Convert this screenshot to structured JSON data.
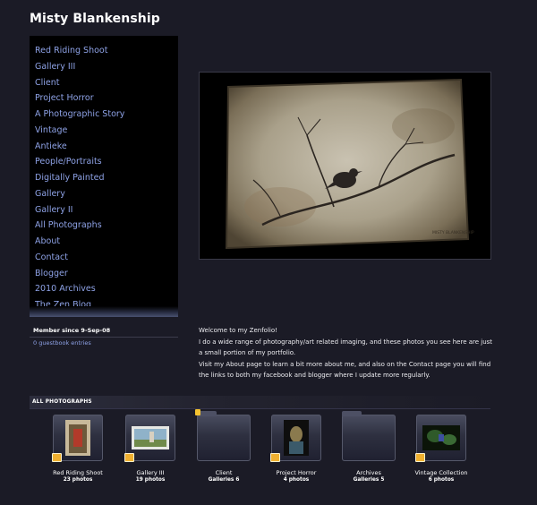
{
  "site": {
    "title": "Misty Blankenship"
  },
  "nav": {
    "items": [
      "Red Riding Shoot",
      "Gallery III",
      "Client",
      "Project Horror",
      "A Photographic Story",
      "Vintage",
      "Antieke",
      "People/Portraits",
      "Digitally Painted",
      "Gallery",
      "Gallery II",
      "All Photographs",
      "About",
      "Contact",
      "Blogger",
      "2010 Archives",
      "The Zen Blog"
    ]
  },
  "member": {
    "since": "Member since 9-Sep-08",
    "guestbook": "0 guestbook entries"
  },
  "feature_image": {
    "watermark": "MISTY BLANKENSHIP"
  },
  "welcome": {
    "heading": "Welcome to my Zenfolio!",
    "para1": "I do a wide range of photography/art related imaging, and these photos you see here are just a small portion of my portfolio.",
    "para2": "Visit my About page to learn a bit more about me, and also on the Contact page you will find the links to both my facebook and blogger where I update more regularly."
  },
  "section": {
    "label": "ALL PHOTOGRAPHS"
  },
  "galleries": [
    {
      "title": "Red Riding Shoot",
      "count": "23 photos",
      "kind": "gallery",
      "icon": "photo-stack-icon"
    },
    {
      "title": "Gallery III",
      "count": "19 photos",
      "kind": "gallery",
      "icon": "photo-stack-icon"
    },
    {
      "title": "Client",
      "count": "Galleries 6",
      "kind": "folder",
      "icon": "folder-icon"
    },
    {
      "title": "Project Horror",
      "count": "4 photos",
      "kind": "gallery",
      "icon": "photo-stack-icon"
    },
    {
      "title": "Archives",
      "count": "Galleries 5",
      "kind": "folder",
      "icon": "folder-icon"
    },
    {
      "title": "Vintage Collection",
      "count": "6 photos",
      "kind": "gallery",
      "icon": "photo-stack-icon"
    }
  ],
  "colors": {
    "page_bg": "#1b1b26",
    "nav_bg": "#000000",
    "link": "#8ea2e6",
    "text": "#ececf0"
  }
}
